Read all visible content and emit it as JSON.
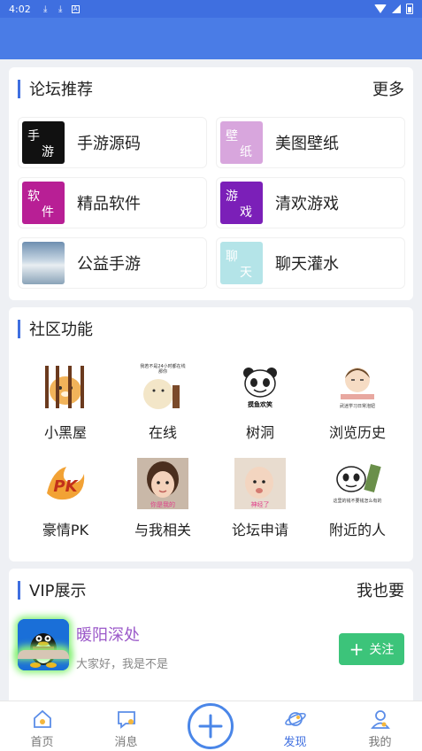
{
  "status": {
    "time": "4:02"
  },
  "forum": {
    "title": "论坛推荐",
    "more": "更多",
    "items": [
      {
        "label": "手游源码",
        "icon_chars": [
          "手",
          "游"
        ],
        "icon_color": "#111111"
      },
      {
        "label": "美图壁纸",
        "icon_chars": [
          "壁",
          "纸"
        ],
        "icon_color": "#d8a6dd"
      },
      {
        "label": "精品软件",
        "icon_chars": [
          "软",
          "件"
        ],
        "icon_color": "#b81f95"
      },
      {
        "label": "清欢游戏",
        "icon_chars": [
          "游",
          "戏"
        ],
        "icon_color": "#7b1fb8"
      },
      {
        "label": "公益手游",
        "icon_chars": [],
        "icon_color": "#8fb0c8"
      },
      {
        "label": "聊天灌水",
        "icon_chars": [
          "聊",
          "天"
        ],
        "icon_color": "#b4e4e8"
      }
    ]
  },
  "community": {
    "title": "社区功能",
    "items": [
      {
        "label": "小黑屋",
        "icon": "jail-bear-icon"
      },
      {
        "label": "在线",
        "icon": "seal-meme-icon",
        "caption": "我若不是24小时都在线 那你"
      },
      {
        "label": "树洞",
        "icon": "panda-meme-icon",
        "caption": "摸鱼欢笑"
      },
      {
        "label": "浏览历史",
        "icon": "studying-girl-icon",
        "caption": "武迷学习日常泡妞"
      },
      {
        "label": "豪情PK",
        "icon": "pk-flame-icon"
      },
      {
        "label": "与我相关",
        "icon": "girl-photo-icon",
        "caption": "你是我的"
      },
      {
        "label": "论坛申请",
        "icon": "baby-photo-icon",
        "caption": "神经了"
      },
      {
        "label": "附近的人",
        "icon": "panda-money-icon",
        "caption": "这里的钱不要钱怎么有的"
      }
    ]
  },
  "vip": {
    "title": "VIP展示",
    "more": "我也要",
    "user": {
      "name": "暖阳深处",
      "desc": "大家好，我是不是",
      "follow": "关注"
    }
  },
  "nav": {
    "items": [
      {
        "label": "首页",
        "icon": "home-icon"
      },
      {
        "label": "消息",
        "icon": "message-icon"
      },
      {
        "label": "发现",
        "icon": "planet-icon",
        "active": true
      },
      {
        "label": "我的",
        "icon": "user-icon"
      }
    ]
  },
  "colors": {
    "accent": "#3f6fe0",
    "appbar": "#4a7ce6",
    "follow": "#3cc47a"
  }
}
